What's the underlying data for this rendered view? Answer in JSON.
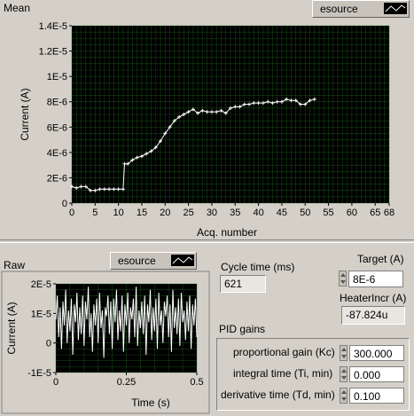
{
  "mean": {
    "title": "Mean",
    "legend_label": "esource",
    "xlabel": "Acq. number",
    "ylabel": "Current (A)",
    "x_ticks": [
      "0",
      "5",
      "10",
      "15",
      "20",
      "25",
      "30",
      "35",
      "40",
      "45",
      "50",
      "55",
      "60",
      "65",
      "68"
    ],
    "y_ticks": [
      "0",
      "2E-6",
      "4E-6",
      "6E-6",
      "8E-6",
      "1E-5",
      "1.2E-5",
      "1.4E-5"
    ]
  },
  "raw": {
    "title": "Raw",
    "legend_label": "esource",
    "xlabel": "Time (s)",
    "ylabel": "Current (A)",
    "x_ticks": [
      "0",
      "0.25",
      "0.5"
    ],
    "y_ticks": [
      "-1E-5",
      "0",
      "1E-5",
      "2E-5"
    ]
  },
  "cycle_time": {
    "label": "Cycle time (ms)",
    "value": "621"
  },
  "target": {
    "label": "Target (A)",
    "value": "8E-6"
  },
  "heater": {
    "label": "HeaterIncr (A)",
    "value": "-87.824u"
  },
  "pid": {
    "title": "PID gains",
    "kc_label": "proportional gain (Kc)",
    "kc_value": "300.000",
    "ti_label": "integral time (Ti, min)",
    "ti_value": "0.000",
    "td_label": "derivative time (Td, min)",
    "td_value": "0.100"
  },
  "chart_data": [
    {
      "type": "line",
      "title": "Mean",
      "xlabel": "Acq. number",
      "ylabel": "Current (A)",
      "xlim": [
        0,
        68
      ],
      "ylim": [
        0,
        1.4e-05
      ],
      "grid": true,
      "background": "#000000",
      "grid_color": "#1f6b1f",
      "line_color": "#ffffff",
      "series": [
        {
          "name": "esource",
          "x": [
            0,
            1,
            2,
            3,
            4,
            5,
            6,
            7,
            8,
            9,
            10,
            11,
            11.3,
            12,
            13,
            14,
            15,
            16,
            17,
            18,
            19,
            20,
            21,
            22,
            23,
            24,
            25,
            26,
            27,
            28,
            29,
            30,
            31,
            32,
            33,
            34,
            35,
            36,
            37,
            38,
            39,
            40,
            41,
            42,
            43,
            44,
            45,
            46,
            47,
            48,
            49,
            50,
            51,
            52
          ],
          "y": [
            1.3e-06,
            1.2e-06,
            1.3e-06,
            1.3e-06,
            1e-06,
            1e-06,
            1.1e-06,
            1.1e-06,
            1.1e-06,
            1.1e-06,
            1.1e-06,
            1.1e-06,
            3.1e-06,
            3.1e-06,
            3.4e-06,
            3.6e-06,
            3.7e-06,
            3.9e-06,
            4.1e-06,
            4.4e-06,
            4.9e-06,
            5.5e-06,
            6e-06,
            6.5e-06,
            6.8e-06,
            7e-06,
            7.2e-06,
            7.4e-06,
            7.1e-06,
            7.3e-06,
            7.2e-06,
            7.2e-06,
            7.2e-06,
            7.3e-06,
            7.1e-06,
            7.5e-06,
            7.6e-06,
            7.6e-06,
            7.8e-06,
            7.8e-06,
            7.9e-06,
            7.9e-06,
            7.9e-06,
            8e-06,
            7.9e-06,
            8e-06,
            8e-06,
            8.2e-06,
            8.1e-06,
            8.1e-06,
            7.8e-06,
            7.8e-06,
            8.1e-06,
            8.2e-06
          ]
        }
      ]
    },
    {
      "type": "line",
      "title": "Raw",
      "xlabel": "Time (s)",
      "ylabel": "Current (A)",
      "xlim": [
        0,
        0.5
      ],
      "ylim": [
        -1e-05,
        2e-05
      ],
      "grid": true,
      "background": "#000000",
      "grid_color": "#1f6b1f",
      "line_color": "#ffffff",
      "series": [
        {
          "name": "esource",
          "x": [
            0,
            0.005,
            0.01,
            0.015,
            0.02,
            0.025,
            0.03,
            0.035,
            0.04,
            0.045,
            0.05,
            0.055,
            0.06,
            0.065,
            0.07,
            0.075,
            0.08,
            0.085,
            0.09,
            0.095,
            0.1,
            0.105,
            0.11,
            0.115,
            0.12,
            0.125,
            0.13,
            0.135,
            0.14,
            0.145,
            0.15,
            0.155,
            0.16,
            0.165,
            0.17,
            0.175,
            0.18,
            0.185,
            0.19,
            0.195,
            0.2,
            0.205,
            0.21,
            0.215,
            0.22,
            0.225,
            0.23,
            0.235,
            0.24,
            0.245,
            0.25,
            0.255,
            0.26,
            0.265,
            0.27,
            0.275,
            0.28,
            0.285,
            0.29,
            0.295,
            0.3,
            0.305,
            0.31,
            0.315,
            0.32,
            0.325,
            0.33,
            0.335,
            0.34,
            0.345,
            0.35,
            0.355,
            0.36,
            0.365,
            0.37,
            0.375,
            0.38,
            0.385,
            0.39,
            0.395,
            0.4,
            0.405,
            0.41,
            0.415,
            0.42,
            0.425,
            0.43,
            0.435,
            0.44,
            0.445,
            0.45,
            0.455,
            0.46,
            0.465,
            0.47,
            0.475,
            0.48,
            0.485,
            0.49,
            0.495,
            0.5
          ],
          "y": [
            8e-06,
            1.6e-05,
            2e-06,
            1.2e-05,
            -2e-06,
            1.4e-05,
            6e-06,
            1.8e-05,
            0,
            1.1e-05,
            4e-06,
            1.5e-05,
            -4e-06,
            1.3e-05,
            7e-06,
            1.7e-05,
            1e-06,
            1.2e-05,
            3e-06,
            1.6e-05,
            -1e-06,
            1.4e-05,
            8e-06,
            1.9e-05,
            2e-06,
            1e-05,
            -3e-06,
            1.3e-05,
            6e-06,
            1.5e-05,
            0,
            1.7e-05,
            5e-06,
            1.1e-05,
            -5e-06,
            1.2e-05,
            9e-06,
            1.6e-05,
            3e-06,
            1.4e-05,
            -2e-06,
            1.5e-05,
            7e-06,
            1.8e-05,
            1e-06,
            1.1e-05,
            4e-06,
            1.6e-05,
            -3e-06,
            1.3e-05,
            6e-06,
            1.7e-05,
            0,
            1.2e-05,
            8e-06,
            1.5e-05,
            2e-06,
            1.9e-05,
            -1e-06,
            1.1e-05,
            5e-06,
            1.4e-05,
            3e-06,
            1.6e-05,
            -4e-06,
            1.3e-05,
            7e-06,
            1.8e-05,
            1e-06,
            1.2e-05,
            4e-06,
            1.5e-05,
            -2e-06,
            1.7e-05,
            6e-06,
            1.1e-05,
            0,
            1.4e-05,
            9e-06,
            1.6e-05,
            2e-06,
            1.3e-05,
            -3e-06,
            1.8e-05,
            5e-06,
            1.2e-05,
            3e-06,
            1.5e-05,
            -1e-06,
            1.7e-05,
            7e-06,
            1.1e-05,
            1e-06,
            1.4e-05,
            4e-06,
            1.6e-05,
            -2e-06,
            1.3e-05,
            6e-06,
            1.5e-05,
            2e-06
          ]
        }
      ]
    }
  ]
}
